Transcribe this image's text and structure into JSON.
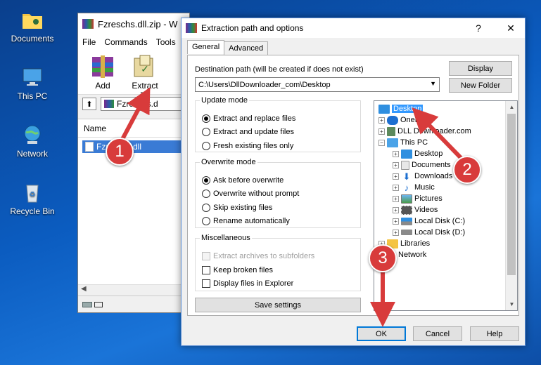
{
  "desktop": {
    "icons": [
      {
        "label": "Documents"
      },
      {
        "label": "This PC"
      },
      {
        "label": "Network"
      },
      {
        "label": "Recycle Bin"
      }
    ]
  },
  "winrar": {
    "title": "Fzreschs.dll.zip - W",
    "menu": [
      "File",
      "Commands",
      "Tools"
    ],
    "toolbar": {
      "add": "Add",
      "extract": "Extract To"
    },
    "path": "Fzreschs.d",
    "column_name": "Name",
    "file": "Fzreschs.dll"
  },
  "dialog": {
    "title": "Extraction path and options",
    "help_glyph": "?",
    "close_glyph": "✕",
    "tabs": [
      "General",
      "Advanced"
    ],
    "dest_label": "Destination path (will be created if does not exist)",
    "dest_value": "C:\\Users\\DllDownloader_com\\Desktop",
    "display_button": "Display",
    "new_folder_button": "New Folder",
    "update_mode": {
      "legend": "Update mode",
      "options": [
        "Extract and replace files",
        "Extract and update files",
        "Fresh existing files only"
      ],
      "selected": 0
    },
    "overwrite_mode": {
      "legend": "Overwrite mode",
      "options": [
        "Ask before overwrite",
        "Overwrite without prompt",
        "Skip existing files",
        "Rename automatically"
      ],
      "selected": 0
    },
    "misc": {
      "legend": "Miscellaneous",
      "options": [
        "Extract archives to subfolders",
        "Keep broken files",
        "Display files in Explorer"
      ]
    },
    "save_settings": "Save settings",
    "tree": [
      {
        "label": "Desktop",
        "selected": true
      },
      {
        "label": "OneDrive"
      },
      {
        "label": "DLL Downloader.com"
      },
      {
        "label": "This PC"
      },
      {
        "label": "Desktop"
      },
      {
        "label": "Documents"
      },
      {
        "label": "Downloads"
      },
      {
        "label": "Music"
      },
      {
        "label": "Pictures"
      },
      {
        "label": "Videos"
      },
      {
        "label": "Local Disk (C:)"
      },
      {
        "label": "Local Disk (D:)"
      },
      {
        "label": "Libraries"
      },
      {
        "label": "Network"
      }
    ],
    "ok_button": "OK",
    "cancel_button": "Cancel",
    "help_button": "Help"
  },
  "markers": [
    "1",
    "2",
    "3"
  ],
  "colors": {
    "accent": "#0078d7",
    "selection": "#3399ff",
    "marker": "#d83b3b"
  }
}
